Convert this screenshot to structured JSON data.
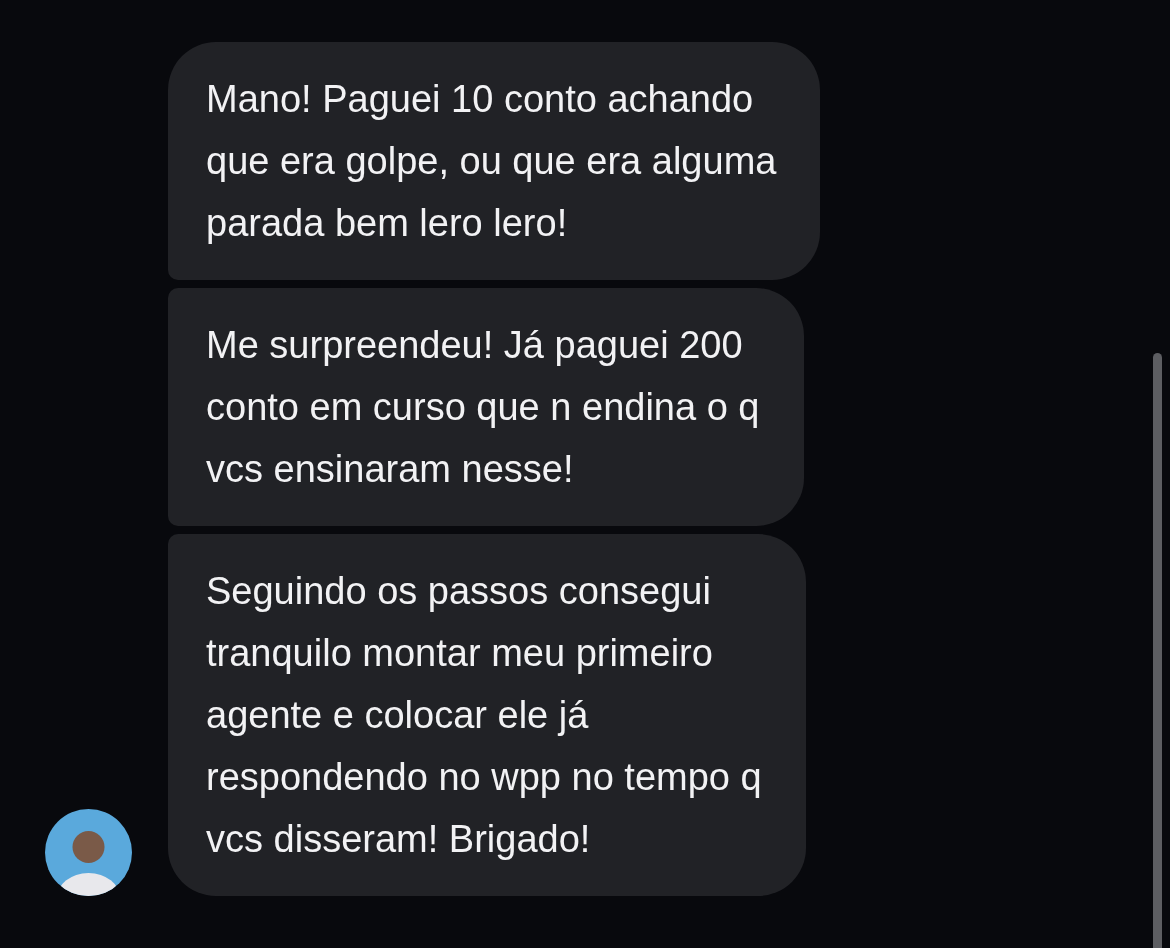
{
  "messages": [
    {
      "kind": "first",
      "text": "Mano! Paguei 10 conto achando\nque era golpe, ou que era alguma\nparada bem lero lero!"
    },
    {
      "kind": "middle",
      "text": "Me surpreendeu! Já paguei 200\nconto em curso que n endina o q\nvcs ensinaram nesse!"
    },
    {
      "kind": "last",
      "text": "Seguindo os passos consegui\ntranquilo montar meu primeiro\nagente e colocar ele já\nrespondendo no wpp no tempo q\nvcs disseram! Brigado!"
    }
  ]
}
